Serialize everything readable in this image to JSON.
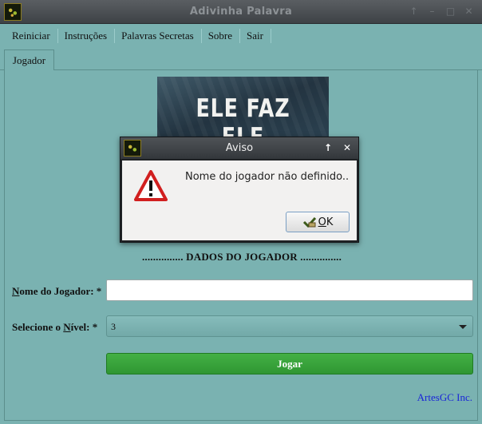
{
  "window": {
    "title": "Adivinha Palavra",
    "controls": [
      "↑",
      "–",
      "□",
      "✕"
    ]
  },
  "menu": {
    "items": [
      "Reiniciar",
      "Instruções",
      "Palavras Secretas",
      "Sobre",
      "Sair"
    ]
  },
  "tabs": [
    {
      "label": "Jogador",
      "active": true
    }
  ],
  "banner": {
    "line1": "ELE FAZ",
    "line2": "ELE DESFAZ"
  },
  "form": {
    "section_title": "............... DADOS DO JOGADOR ...............",
    "name_label_first": "N",
    "name_label_rest": "ome do Jogador: *",
    "name_value": "",
    "level_label_prefix": "Selecione o ",
    "level_label_mnemonic": "N",
    "level_label_rest": "ível: *",
    "level_value": "3",
    "play_button": "Jogar",
    "credit": "ArtesGC Inc."
  },
  "dialog": {
    "title": "Aviso",
    "controls": [
      "↑",
      "✕"
    ],
    "message": "Nome do jogador não definido..",
    "ok_mnemonic": "O",
    "ok_rest": "K"
  },
  "colors": {
    "background": "#7ab2b1",
    "play_button": "#3aa43c",
    "credit_link": "#1a25d8",
    "warning": "#d11f1f"
  }
}
